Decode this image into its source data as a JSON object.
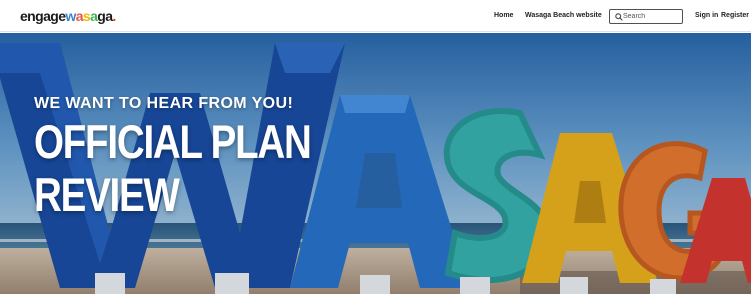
{
  "header": {
    "logo": {
      "part1": "engage",
      "w": "w",
      "a1": "a",
      "s": "s",
      "a2": "a",
      "ga": "ga",
      "dot": "."
    },
    "nav": {
      "home": "Home",
      "website": "Wasaga Beach website",
      "sign_in": "Sign in",
      "register": "Register"
    },
    "search": {
      "placeholder": "Search",
      "icon": "search-icon"
    }
  },
  "hero": {
    "kicker": "WE WANT TO HEAR FROM YOU!",
    "title_line1": "OFFICIAL PLAN",
    "title_line2": "REVIEW",
    "sign_letters": [
      "W",
      "A",
      "S",
      "A",
      "G",
      "A"
    ],
    "colors": {
      "sky_top": "#2f6fb0",
      "sky_bottom": "#9cc3e0",
      "sand": "#cdb59a",
      "letter_w": "#1d4fa6",
      "letter_a1": "#2a78d0",
      "letter_s": "#3db8b2",
      "letter_a2": "#f3b417",
      "letter_g": "#ef7a2a",
      "letter_a3": "#e0362c"
    }
  }
}
